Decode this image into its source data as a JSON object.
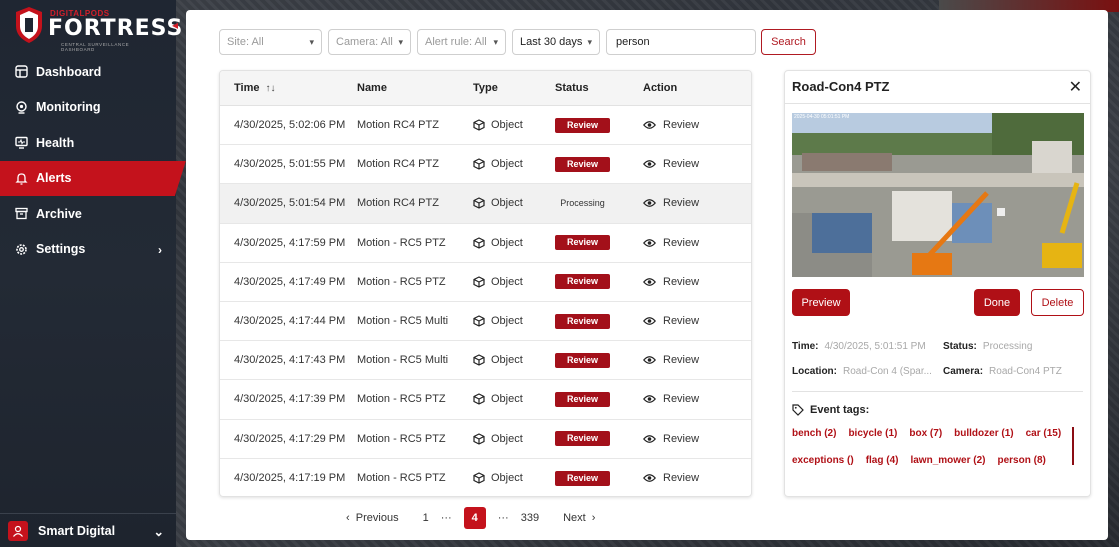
{
  "brand": {
    "top": "DIGITALPODS",
    "main": "FORTRESS",
    "sub": "CENTRAL SURVEILLANCE DASHBOARD"
  },
  "nav": {
    "items": [
      {
        "label": "Dashboard",
        "icon": "grid-icon"
      },
      {
        "label": "Monitoring",
        "icon": "camera-icon"
      },
      {
        "label": "Health",
        "icon": "monitor-icon"
      },
      {
        "label": "Alerts",
        "icon": "bell-icon",
        "active": true
      },
      {
        "label": "Archive",
        "icon": "archive-icon"
      },
      {
        "label": "Settings",
        "icon": "gear-icon",
        "has_children": true
      }
    ]
  },
  "user": {
    "name": "Smart Digital"
  },
  "filters": {
    "site": "Site: All",
    "camera": "Camera: All",
    "alert_rule": "Alert rule: All",
    "range": "Last 30 days",
    "search_value": "person",
    "search_button": "Search"
  },
  "table": {
    "headers": {
      "time": "Time",
      "name": "Name",
      "type": "Type",
      "status": "Status",
      "action": "Action"
    },
    "rows": [
      {
        "time": "4/30/2025, 5:02:06 PM",
        "name": "Motion RC4 PTZ",
        "type": "Object",
        "status": "Review",
        "action": "Review"
      },
      {
        "time": "4/30/2025, 5:01:55 PM",
        "name": "Motion RC4 PTZ",
        "type": "Object",
        "status": "Review",
        "action": "Review"
      },
      {
        "time": "4/30/2025, 5:01:54 PM",
        "name": "Motion RC4 PTZ",
        "type": "Object",
        "status": "Processing",
        "action": "Review"
      },
      {
        "time": "4/30/2025, 4:17:59 PM",
        "name": "Motion - RC5 PTZ",
        "type": "Object",
        "status": "Review",
        "action": "Review"
      },
      {
        "time": "4/30/2025, 4:17:49 PM",
        "name": "Motion - RC5 PTZ",
        "type": "Object",
        "status": "Review",
        "action": "Review"
      },
      {
        "time": "4/30/2025, 4:17:44 PM",
        "name": "Motion - RC5 Multi",
        "type": "Object",
        "status": "Review",
        "action": "Review"
      },
      {
        "time": "4/30/2025, 4:17:43 PM",
        "name": "Motion - RC5 Multi",
        "type": "Object",
        "status": "Review",
        "action": "Review"
      },
      {
        "time": "4/30/2025, 4:17:39 PM",
        "name": "Motion - RC5 PTZ",
        "type": "Object",
        "status": "Review",
        "action": "Review"
      },
      {
        "time": "4/30/2025, 4:17:29 PM",
        "name": "Motion - RC5 PTZ",
        "type": "Object",
        "status": "Review",
        "action": "Review"
      },
      {
        "time": "4/30/2025, 4:17:19 PM",
        "name": "Motion - RC5 PTZ",
        "type": "Object",
        "status": "Review",
        "action": "Review"
      }
    ]
  },
  "pagination": {
    "previous": "Previous",
    "first": "1",
    "ellipsis": "···",
    "current": "4",
    "last": "339",
    "next": "Next"
  },
  "detail": {
    "title": "Road-Con4 PTZ",
    "image_timestamp": "2025-04-30 05:01:51 PM",
    "preview_button": "Preview",
    "done_button": "Done",
    "delete_button": "Delete",
    "time_label": "Time:",
    "time_value": "4/30/2025, 5:01:51 PM",
    "status_label": "Status:",
    "status_value": "Processing",
    "location_label": "Location:",
    "location_value": "Road-Con 4 (Spar...",
    "camera_label": "Camera:",
    "camera_value": "Road-Con4 PTZ",
    "tags_label": "Event tags:",
    "tags": [
      "bench (2)",
      "bicycle (1)",
      "box (7)",
      "bulldozer (1)",
      "car (15)",
      "exceptions ()",
      "flag (4)",
      "lawn_mower (2)",
      "person (8)"
    ]
  },
  "colors": {
    "accent": "#c4121c",
    "badge": "#a3101a",
    "sidebar": "#1f2632"
  }
}
